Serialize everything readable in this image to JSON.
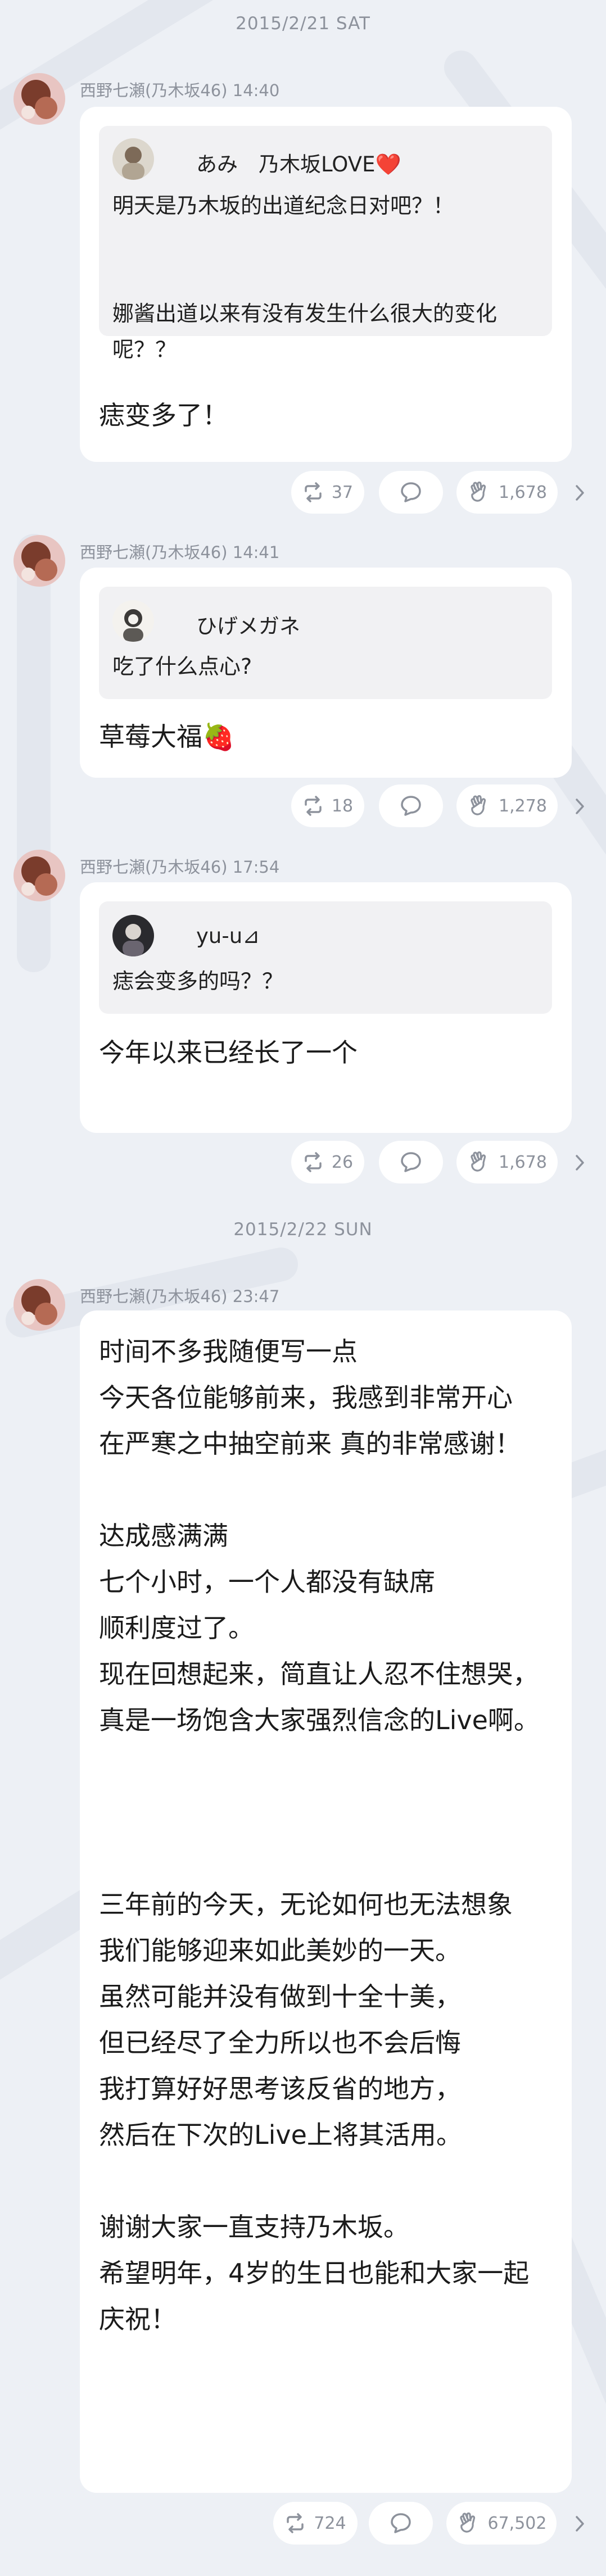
{
  "theme": {
    "background": "#edf0f5",
    "card": "#ffffff",
    "quote_bg": "#f1f1f3",
    "meta_text": "#8d929c"
  },
  "days": [
    {
      "date": "2015/2/21 SAT",
      "posts": [
        {
          "sender": "西野七瀬(乃木坂46)",
          "time": "14:40",
          "quote": {
            "name": "あみ　乃木坂LOVE❤️",
            "text": "明天是乃木坂的出道纪念日对吧？！\n\n\n娜酱出道以来有没有发生什么很大的变化呢？？"
          },
          "reply": "痣变多了！",
          "reactions": {
            "repost": "37",
            "comment": "",
            "clap": "1,678"
          }
        },
        {
          "sender": "西野七瀬(乃木坂46)",
          "time": "14:41",
          "quote": {
            "name": "ひげメガネ",
            "text": "吃了什么点心?"
          },
          "reply": "草莓大福🍓",
          "reactions": {
            "repost": "18",
            "comment": "",
            "clap": "1,278"
          }
        },
        {
          "sender": "西野七瀬(乃木坂46)",
          "time": "17:54",
          "quote": {
            "name": "yu-u⊿",
            "text": "痣会变多的吗？？"
          },
          "reply": "今年以来已经长了一个",
          "reactions": {
            "repost": "26",
            "comment": "",
            "clap": "1,678"
          }
        }
      ]
    },
    {
      "date": "2015/2/22 SUN",
      "posts": [
        {
          "sender": "西野七瀬(乃木坂46)",
          "time": "23:47",
          "message": "时间不多我随便写一点\n今天各位能够前来，我感到非常开心\n在严寒之中抽空前来 真的非常感谢！\n\n达成感满满\n七个小时，一个人都没有缺席\n顺利度过了。\n现在回想起来，简直让人忍不住想哭，\n真是一场饱含大家强烈信念的Live啊。\n\n\n\n三年前的今天，无论如何也无法想象\n我们能够迎来如此美妙的一天。\n虽然可能并没有做到十全十美，\n但已经尽了全力所以也不会后悔\n我打算好好思考该反省的地方，\n然后在下次的Live上将其活用。\n\n谢谢大家一直支持乃木坂。\n希望明年，4岁的生日也能和大家一起\n庆祝！",
          "reactions": {
            "repost": "724",
            "comment": "",
            "clap": "67,502"
          }
        }
      ]
    }
  ],
  "icons": {
    "repost": "repost-icon",
    "comment": "comment-icon",
    "clap": "clap-icon",
    "more": "chevron-right-icon"
  }
}
